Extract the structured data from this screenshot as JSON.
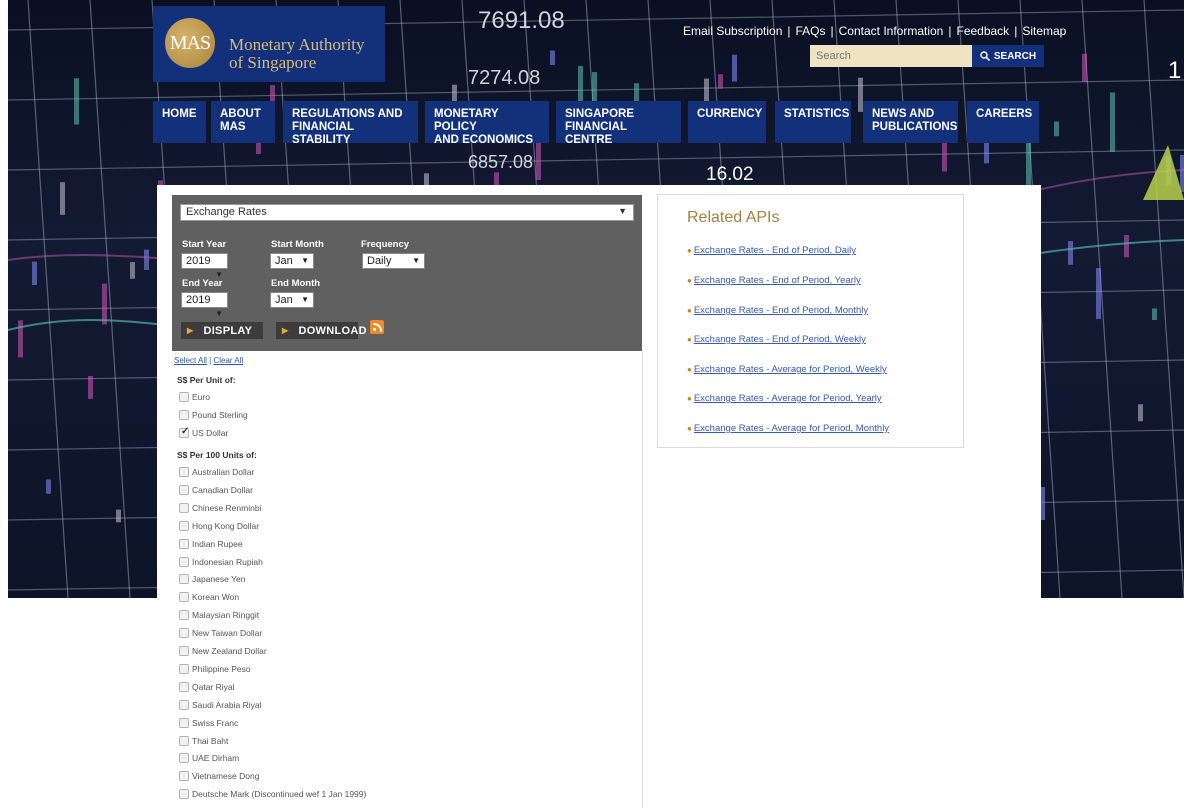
{
  "header": {
    "logo_seal": "MAS",
    "logo_line1": "Monetary Authority",
    "logo_line2": "of Singapore"
  },
  "utility_links": [
    "Email Subscription",
    "FAQs",
    "Contact Information",
    "Feedback",
    "Sitemap"
  ],
  "search": {
    "placeholder": "Search",
    "button_label": "SEARCH"
  },
  "nav": [
    {
      "line1": "HOME",
      "line2": ""
    },
    {
      "line1": "ABOUT",
      "line2": "MAS"
    },
    {
      "line1": "REGULATIONS AND",
      "line2": "FINANCIAL STABILITY"
    },
    {
      "line1": "MONETARY POLICY",
      "line2": "AND ECONOMICS"
    },
    {
      "line1": "SINGAPORE",
      "line2": "FINANCIAL CENTRE"
    },
    {
      "line1": "CURRENCY",
      "line2": ""
    },
    {
      "line1": "STATISTICS",
      "line2": ""
    },
    {
      "line1": "NEWS AND",
      "line2": "PUBLICATIONS"
    },
    {
      "line1": "CAREERS",
      "line2": ""
    }
  ],
  "background_numbers": [
    "7691.08",
    "7274.08",
    "6857.08",
    "16.02",
    "1"
  ],
  "filter": {
    "dataset": "Exchange Rates",
    "start_year_label": "Start Year",
    "start_year": "2019",
    "start_month_label": "Start Month",
    "start_month": "Jan",
    "frequency_label": "Frequency",
    "frequency": "Daily",
    "end_year_label": "End Year",
    "end_year": "2019",
    "end_month_label": "End Month",
    "end_month": "Jan",
    "display_label": "DISPLAY",
    "download_label": "DOWNLOAD"
  },
  "selection": {
    "select_all": "Select All",
    "divider": "|",
    "clear_all": "Clear All",
    "group1_label": "S$ Per Unit of:",
    "group1": [
      {
        "label": "Euro",
        "checked": false
      },
      {
        "label": "Pound Sterling",
        "checked": false
      },
      {
        "label": "US Dollar",
        "checked": true
      }
    ],
    "group2_label": "S$ Per 100 Units of:",
    "group2": [
      {
        "label": "Australian Dollar",
        "checked": false
      },
      {
        "label": "Canadian Dollar",
        "checked": false
      },
      {
        "label": "Chinese Renminbi",
        "checked": false
      },
      {
        "label": "Hong Kong Dollar",
        "checked": false
      },
      {
        "label": "Indian Rupee",
        "checked": false
      },
      {
        "label": "Indonesian Rupiah",
        "checked": false
      },
      {
        "label": "Japanese Yen",
        "checked": false
      },
      {
        "label": "Korean Won",
        "checked": false
      },
      {
        "label": "Malaysian Ringgit",
        "checked": false
      },
      {
        "label": "New Taiwan Dollar",
        "checked": false
      },
      {
        "label": "New Zealand Dollar",
        "checked": false
      },
      {
        "label": "Philippine Peso",
        "checked": false
      },
      {
        "label": "Qatar Riyal",
        "checked": false
      },
      {
        "label": "Saudi Arabia Riyal",
        "checked": false
      },
      {
        "label": "Swiss Franc",
        "checked": false
      },
      {
        "label": "Thai Baht",
        "checked": false
      },
      {
        "label": "UAE Dirham",
        "checked": false
      },
      {
        "label": "Vietnamese Dong",
        "checked": false
      },
      {
        "label": "Deutsche Mark (Discontinued wef 1 Jan 1999)",
        "checked": false
      }
    ]
  },
  "related": {
    "title": "Related APIs",
    "links": [
      "Exchange Rates - End of Period, Daily",
      "Exchange Rates - End of Period, Yearly",
      "Exchange Rates - End of Period, Monthly",
      "Exchange Rates - End of Period, Weekly",
      "Exchange Rates - Average for Period, Weekly",
      "Exchange Rates - Average for Period, Yearly",
      "Exchange Rates - Average for Period, Monthly"
    ]
  },
  "colors": {
    "nav_bg": "#13307a",
    "logo_gold": "#d8bd7a",
    "panel_bg": "#606060",
    "link_blue": "#3a59b4",
    "related_title": "#a5823d"
  }
}
